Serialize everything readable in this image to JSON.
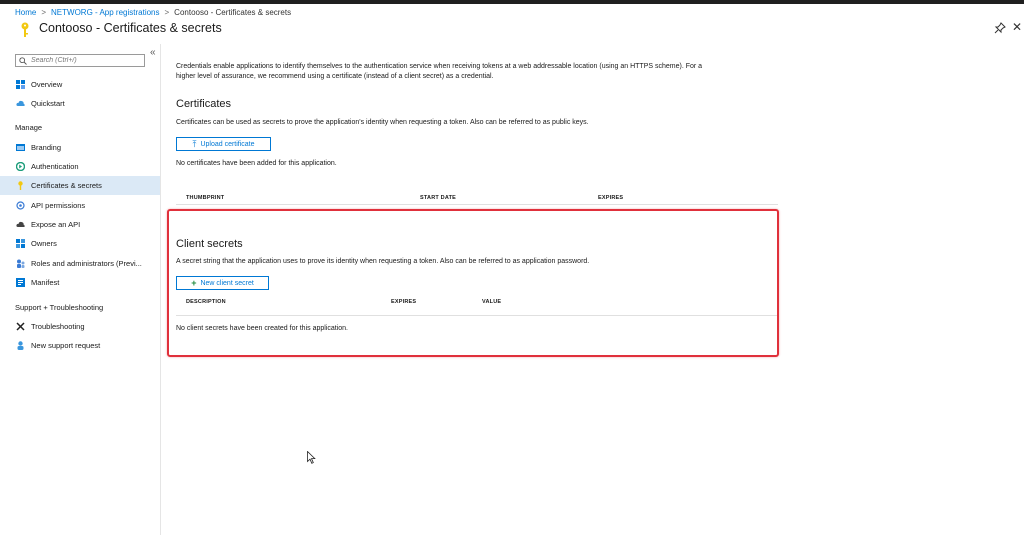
{
  "breadcrumb": {
    "items": [
      "Home",
      "NETWORG - App registrations",
      "Contooso - Certificates & secrets"
    ],
    "separator": ">"
  },
  "page": {
    "title": "Contooso - Certificates & secrets"
  },
  "sidebar": {
    "search_placeholder": "Search (Ctrl+/)",
    "collapse_glyph": "«",
    "top_items": [
      {
        "label": "Overview",
        "icon": "grid-icon"
      },
      {
        "label": "Quickstart",
        "icon": "cloud-icon"
      }
    ],
    "manage_heading": "Manage",
    "manage_items": [
      {
        "label": "Branding",
        "icon": "branding-icon"
      },
      {
        "label": "Authentication",
        "icon": "authentication-icon"
      },
      {
        "label": "Certificates & secrets",
        "icon": "key-icon",
        "active": true
      },
      {
        "label": "API permissions",
        "icon": "api-permissions-icon"
      },
      {
        "label": "Expose an API",
        "icon": "cloud-api-icon"
      },
      {
        "label": "Owners",
        "icon": "owners-icon"
      },
      {
        "label": "Roles and administrators (Previ...",
        "icon": "roles-icon"
      },
      {
        "label": "Manifest",
        "icon": "manifest-icon"
      }
    ],
    "support_heading": "Support + Troubleshooting",
    "support_items": [
      {
        "label": "Troubleshooting",
        "icon": "wrench-icon"
      },
      {
        "label": "New support request",
        "icon": "support-person-icon"
      }
    ]
  },
  "main": {
    "intro_line1": "Credentials enable applications to identify themselves to the authentication service when receiving tokens at a web addressable location (using an HTTPS scheme). For a",
    "intro_line2": "higher level of assurance, we recommend using a certificate (instead of a client secret) as a credential.",
    "certificates": {
      "heading": "Certificates",
      "description": "Certificates can be used as secrets to prove the application's identity when requesting a token. Also can be referred to as public keys.",
      "upload_button": "Upload certificate",
      "empty_message": "No certificates have been added for this application.",
      "columns": [
        "THUMBPRINT",
        "START DATE",
        "EXPIRES"
      ]
    },
    "client_secrets": {
      "heading": "Client secrets",
      "description": "A secret string that the application uses to prove its identity when requesting a token. Also can be referred to as application password.",
      "new_button": "New client secret",
      "columns": [
        "DESCRIPTION",
        "EXPIRES",
        "VALUE"
      ],
      "empty_message": "No client secrets have been created for this application."
    }
  },
  "colors": {
    "accent": "#0078d4",
    "highlight_box": "#e0303b",
    "active_nav_bg": "#dbe9f6"
  }
}
